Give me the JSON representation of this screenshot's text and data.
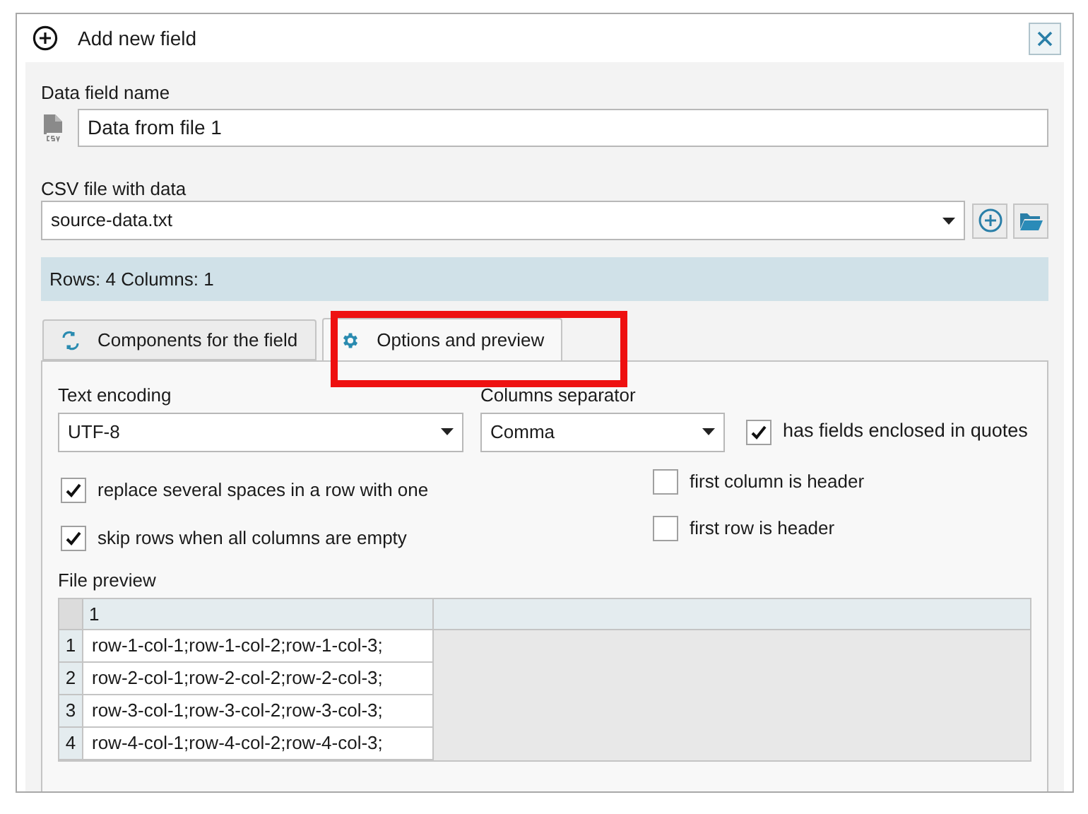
{
  "window": {
    "title": "Add new field"
  },
  "data_field_name": {
    "label": "Data field name",
    "value": "Data from file 1"
  },
  "csv_file": {
    "label": "CSV file with data",
    "value": "source-data.txt"
  },
  "summary": "Rows: 4 Columns: 1",
  "tabs": [
    {
      "label": "Components for the field",
      "selected": false
    },
    {
      "label": "Options and preview",
      "selected": true
    }
  ],
  "text_encoding": {
    "label": "Text encoding",
    "value": "UTF-8"
  },
  "columns_separator": {
    "label": "Columns separator",
    "value": "Comma"
  },
  "options": [
    {
      "label": "has fields enclosed in quotes",
      "checked": true
    },
    {
      "label": "replace several spaces in a row with one",
      "checked": true
    },
    {
      "label": "skip rows when all columns are empty",
      "checked": true
    },
    {
      "label": "first column is header",
      "checked": false
    },
    {
      "label": "first row is header",
      "checked": false
    }
  ],
  "file_preview": {
    "label": "File preview",
    "columns": [
      "1"
    ],
    "rows": [
      {
        "number": "1",
        "cells": [
          "row-1-col-1;row-1-col-2;row-1-col-3;"
        ]
      },
      {
        "number": "2",
        "cells": [
          "row-2-col-1;row-2-col-2;row-2-col-3;"
        ]
      },
      {
        "number": "3",
        "cells": [
          "row-3-col-1;row-3-col-2;row-3-col-3;"
        ]
      },
      {
        "number": "4",
        "cells": [
          "row-4-col-1;row-4-col-2;row-4-col-3;"
        ]
      }
    ]
  }
}
